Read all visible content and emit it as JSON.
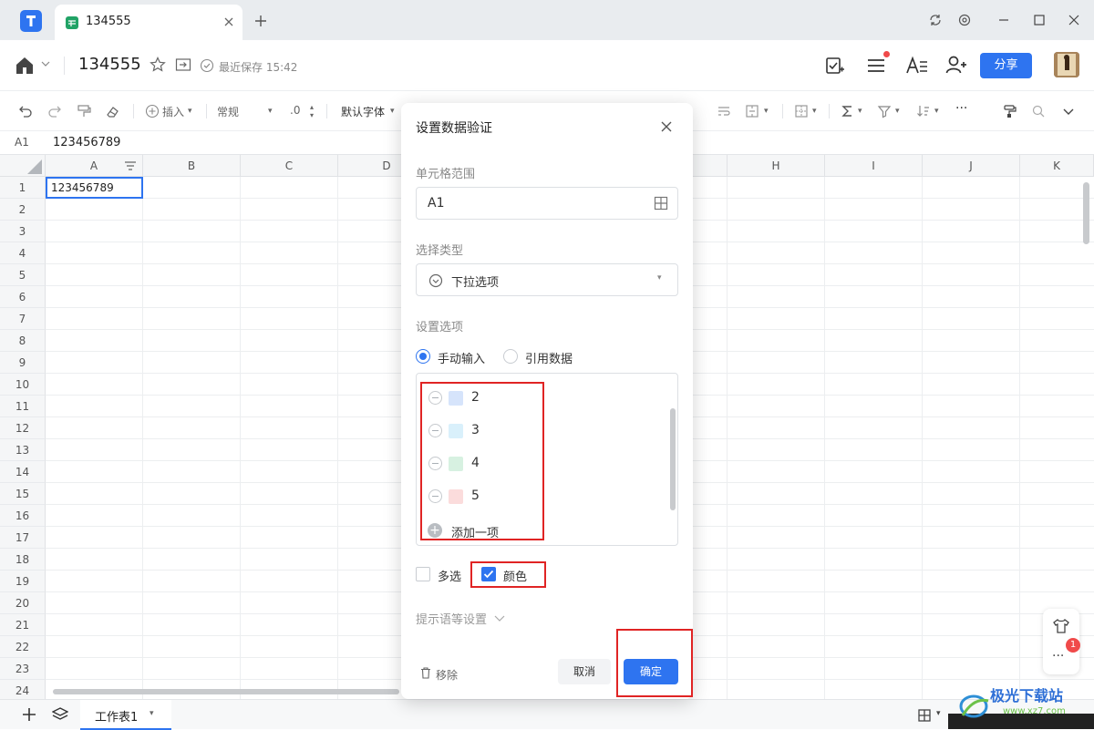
{
  "tab": {
    "title": "134555"
  },
  "header": {
    "doc_title": "134555",
    "save_status": "最近保存 15:42",
    "share_label": "分享"
  },
  "toolbar": {
    "insert_label": "插入",
    "format_label": "常规",
    "decimal_label": ".0",
    "font_label": "默认字体"
  },
  "formula": {
    "cell_ref": "A1",
    "value": "123456789"
  },
  "grid": {
    "columns": [
      "A",
      "B",
      "C",
      "D",
      "H",
      "I",
      "J",
      "K"
    ],
    "rows": [
      "1",
      "2",
      "3",
      "4",
      "5",
      "6",
      "7",
      "8",
      "9",
      "10",
      "11",
      "12",
      "13",
      "14",
      "15",
      "16",
      "17",
      "18",
      "19",
      "20",
      "21",
      "22",
      "23",
      "24"
    ],
    "a1_value": "123456789"
  },
  "sheet": {
    "tab_label": "工作表1"
  },
  "side_widget": {
    "badge_count": "1"
  },
  "dialog": {
    "title": "设置数据验证",
    "range_label": "单元格范围",
    "range_value": "A1",
    "type_label": "选择类型",
    "type_value": "下拉选项",
    "options_label": "设置选项",
    "radio_manual": "手动输入",
    "radio_reference": "引用数据",
    "options": [
      {
        "text": "2",
        "color": "#d6e4fb"
      },
      {
        "text": "3",
        "color": "#d9f0fb"
      },
      {
        "text": "4",
        "color": "#d7f1e1"
      },
      {
        "text": "5",
        "color": "#fbdcdc"
      }
    ],
    "add_option_label": "添加一项",
    "multi_select_label": "多选",
    "color_label": "颜色",
    "hint_settings_label": "提示语等设置",
    "remove_label": "移除",
    "cancel_label": "取消",
    "confirm_label": "确定"
  },
  "watermark": {
    "text": "极光下载站",
    "sub": "www.xz7.com"
  },
  "colors": {
    "accent": "#2e74f0",
    "annotation": "#e02424"
  }
}
